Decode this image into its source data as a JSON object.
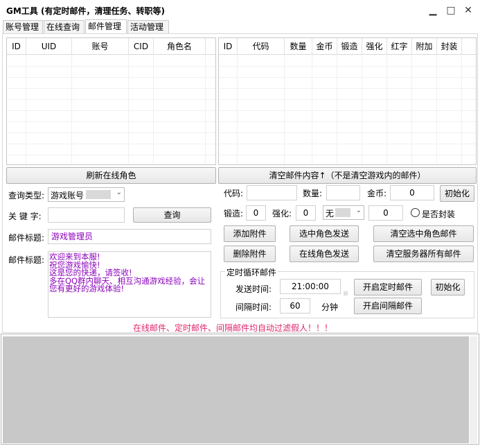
{
  "window": {
    "title": "GM工具 (有定时邮件，清理任务、转职等)",
    "minimize_glyph": "▁",
    "maximize_glyph": "□",
    "close_glyph": "✕"
  },
  "tabs": [
    {
      "label": "账号管理"
    },
    {
      "label": "在线查询"
    },
    {
      "label": "邮件管理"
    },
    {
      "label": "活动管理"
    }
  ],
  "left_grid": {
    "columns": [
      "ID",
      "UID",
      "账号",
      "CID",
      "角色名"
    ]
  },
  "right_grid": {
    "columns": [
      "ID",
      "代码",
      "数量",
      "金币",
      "锻造",
      "强化",
      "红字",
      "附加",
      "封装"
    ]
  },
  "buttons": {
    "refresh_online": "刷新在线角色",
    "clear_mail": "清空邮件内容↑（不是清空游戏内的邮件）",
    "query": "查询",
    "init_top": "初始化",
    "add_attachment": "添加附件",
    "delete_attachment": "删除附件",
    "send_selected": "选中角色发送",
    "send_online": "在线角色发送",
    "clear_selected_mail": "清空选中角色邮件",
    "clear_server_mail": "清空服务器所有邮件",
    "start_timed_mail": "开启定时邮件",
    "start_interval_mail": "开启间隔邮件",
    "init_bottom": "初始化"
  },
  "query": {
    "type_label": "查询类型:",
    "type_value": "游戏账号",
    "keyword_label": "关 键 字:",
    "keyword_value": ""
  },
  "mail": {
    "title_label": "邮件标题:",
    "title_value": "游戏管理员",
    "body_label": "邮件标题:",
    "body_value": "欢迎来到本服!\n祝您游戏愉快!\n这是您的快递，请签收!\n多在QQ群内聊天、相互沟通游戏经验，会让\n您有更好的游戏体验!"
  },
  "item": {
    "code_label": "代码:",
    "code_value": "",
    "count_label": "数量:",
    "count_value": "",
    "gold_label": "金币:",
    "gold_value": "0",
    "forge_label": "锻造:",
    "forge_value": "0",
    "enhance_label": "强化:",
    "enhance_value": "0",
    "attr_value": "无",
    "attr_number": "0",
    "sealed_label": "是否封装"
  },
  "timed": {
    "group_title": "定时循环邮件",
    "send_time_label": "发送时间:",
    "send_time_value": "21:00:00",
    "interval_label": "间隔时间:",
    "interval_value": "60",
    "interval_unit": "分钟"
  },
  "notice": {
    "text": "在线邮件、定时邮件、间隔邮件均自动过滤假人！！！",
    "color": "#e0246b"
  },
  "colors": {
    "mail_body_text": "#8b00b9",
    "log_area_bg": "#c8c8c8"
  }
}
